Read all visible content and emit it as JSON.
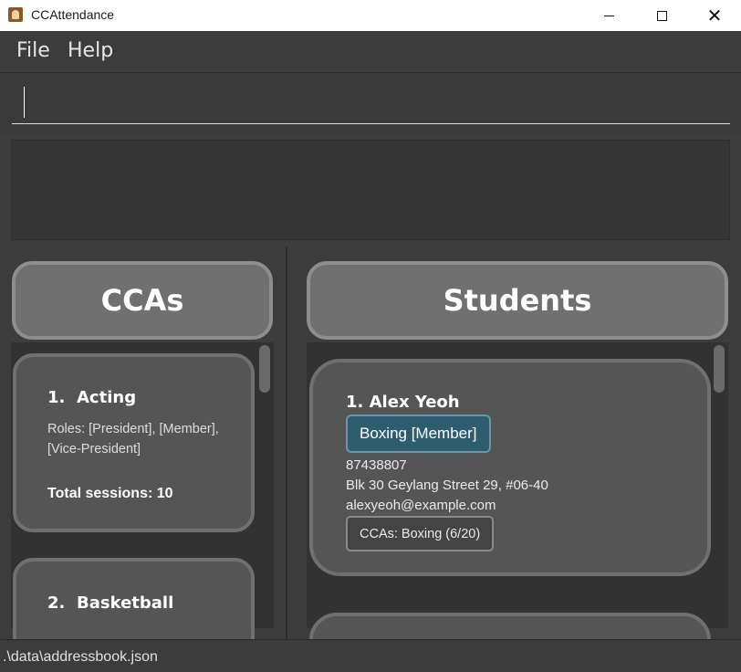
{
  "window": {
    "title": "CCAttendance",
    "icon": "app-icon"
  },
  "menu": {
    "file": "File",
    "help": "Help"
  },
  "command": {
    "value": "",
    "placeholder": ""
  },
  "result": {
    "text": ""
  },
  "ccas_panel": {
    "title": "CCAs",
    "items": [
      {
        "index": "1.",
        "name": "Acting",
        "roles": "Roles: [President], [Member], [Vice-President]",
        "sessions": "Total sessions: 10"
      },
      {
        "index": "2.",
        "name": "Basketball"
      }
    ]
  },
  "students_panel": {
    "title": "Students",
    "items": [
      {
        "name": "1. Alex Yeoh",
        "tag": "Boxing [Member]",
        "phone": "87438807",
        "address": "Blk 30 Geylang Street 29, #06-40",
        "email": "alexyeoh@example.com",
        "ccas": "CCAs: Boxing (6/20)"
      }
    ]
  },
  "status": {
    "path": ".\\data\\addressbook.json"
  }
}
